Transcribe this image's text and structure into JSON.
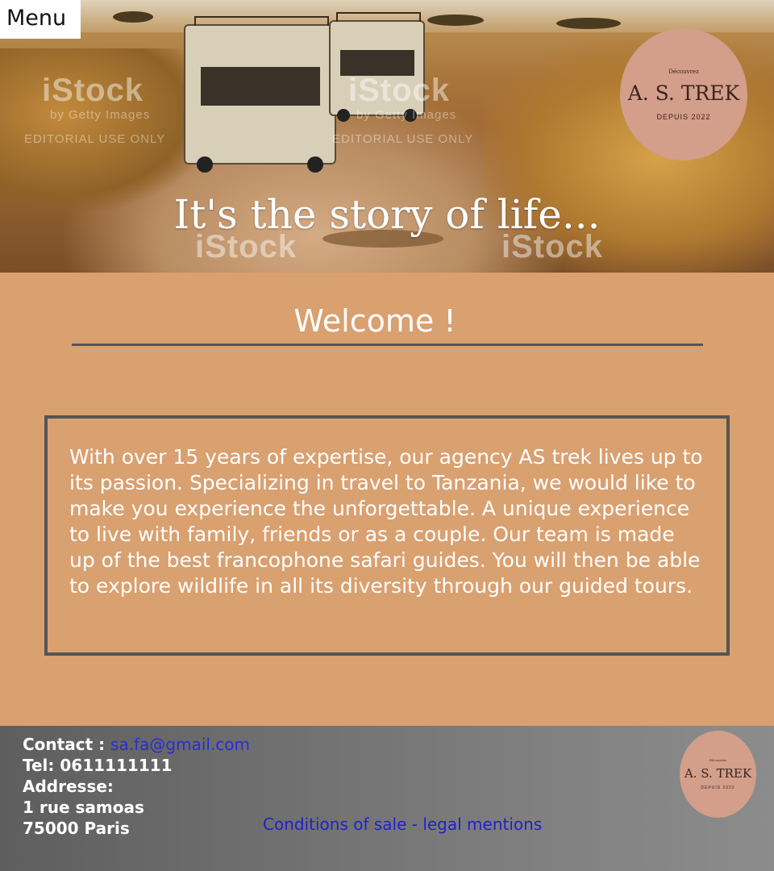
{
  "menu": {
    "label": "Menu"
  },
  "hero": {
    "tagline": "It's the story of life...",
    "watermark": "iStock",
    "watermark_sub": "by Getty Images",
    "watermark_editorial": "EDITORIAL USE ONLY",
    "image_icon": "safari-photo"
  },
  "logo": {
    "top": "Découvrez",
    "name": "A. S. TREK",
    "since": "DEPUIS 2022"
  },
  "main": {
    "welcome": "Welcome !",
    "about": "With over 15 years of expertise, our agency AS trek lives up to its passion. Specializing in travel to Tanzania, we would like to make you experience the unforgettable. A unique experience to live with family, friends or as a couple. Our team is made up of the best francophone safari guides. You will then be able to explore wildlife in all its diversity through our guided tours."
  },
  "footer": {
    "contact_label": "Contact :",
    "email": "sa.fa@gmail.com",
    "tel": "Tel: 0611111111",
    "address_label": "Addresse:",
    "street": "1 rue samoas",
    "city": "75000 Paris",
    "legal_link": "Conditions of sale - legal mentions"
  },
  "colors": {
    "main_bg": "#d9a070",
    "logo_bg": "#d39e8a",
    "link": "#2b2bd8",
    "rule": "#555555"
  }
}
